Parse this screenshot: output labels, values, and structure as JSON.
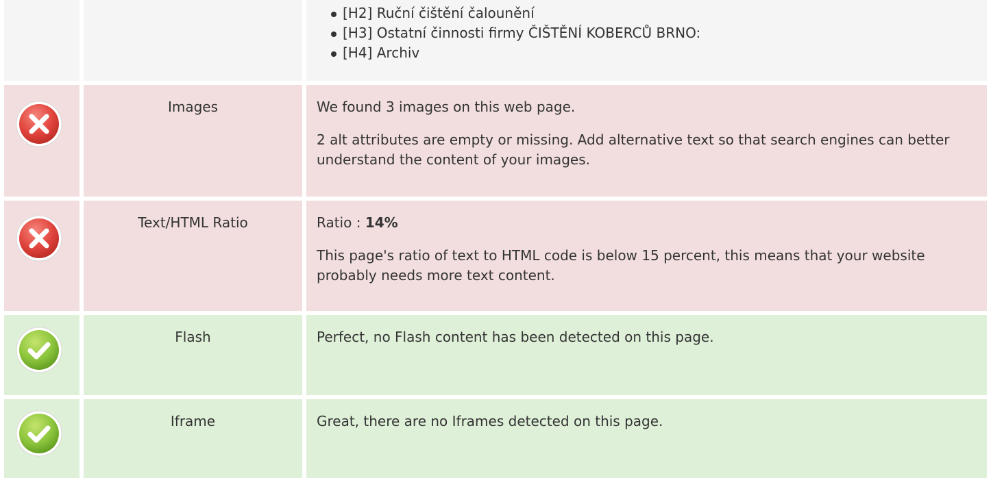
{
  "headings_row": {
    "items": [
      "[H2] Ruční čištění čalounění",
      "[H3] Ostatní činnosti firmy ČIŠTĚNÍ KOBERCŮ BRNO:",
      "[H4] Archiv"
    ]
  },
  "rows": [
    {
      "status": "error",
      "icon": "error-x-icon",
      "label": "Images",
      "line1": "We found 3 images on this web page.",
      "line2": "2 alt attributes are empty or missing. Add alternative text so that search engines can better understand the content of your images."
    },
    {
      "status": "error",
      "icon": "error-x-icon",
      "label": "Text/HTML Ratio",
      "ratio_prefix": "Ratio : ",
      "ratio_value": "14%",
      "line2": "This page's ratio of text to HTML code is below 15 percent, this means that your website probably needs more text content."
    },
    {
      "status": "success",
      "icon": "check-icon",
      "label": "Flash",
      "line1": "Perfect, no Flash content has been detected on this page."
    },
    {
      "status": "success",
      "icon": "check-icon",
      "label": "Iframe",
      "line1": "Great, there are no Iframes detected on this page."
    }
  ],
  "colors": {
    "neutral_bg": "#f5f5f5",
    "error_bg": "#f2dede",
    "success_bg": "#dff0d8",
    "error_icon": "#e0443c",
    "success_icon": "#8cc43c"
  }
}
